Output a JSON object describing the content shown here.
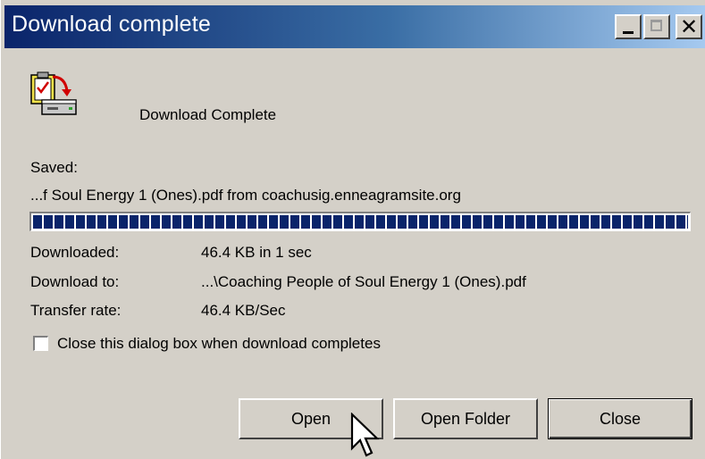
{
  "window": {
    "title": "Download complete",
    "controls": {
      "minimize": "_",
      "maximize": "□",
      "close": "✕"
    }
  },
  "header": {
    "icon": "download-complete-icon",
    "message": "Download Complete"
  },
  "saved": {
    "label": "Saved:",
    "description": "...f Soul Energy 1 (Ones).pdf from coachusig.enneagramsite.org"
  },
  "progress": {
    "fraction": 1.0
  },
  "details": [
    {
      "label": "Downloaded:",
      "value": "46.4 KB in 1 sec"
    },
    {
      "label": "Download to:",
      "value": "...\\Coaching People of Soul Energy 1 (Ones).pdf"
    },
    {
      "label": "Transfer rate:",
      "value": "46.4 KB/Sec"
    }
  ],
  "options": {
    "close_on_complete": {
      "label": "Close this dialog box when download completes",
      "checked": false
    }
  },
  "buttons": {
    "open": "Open",
    "open_folder": "Open Folder",
    "close": "Close"
  },
  "colors": {
    "title_start": "#0a246a",
    "title_end": "#a6caf0",
    "dialog_bg": "#d4d0c8",
    "progress": "#0a246a"
  }
}
